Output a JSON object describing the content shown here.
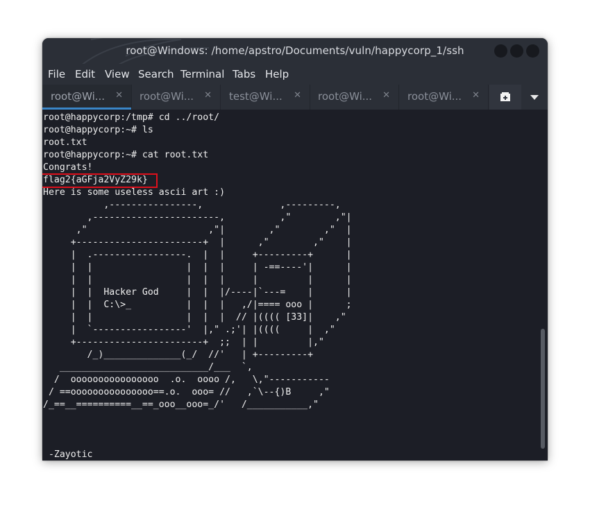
{
  "window": {
    "title": "root@Windows: /home/apstro/Documents/vuln/happycorp_1/ssh"
  },
  "menubar": {
    "items": [
      "File",
      "Edit",
      "View",
      "Search",
      "Terminal",
      "Tabs",
      "Help"
    ]
  },
  "tabs": [
    {
      "label": "root@Wi...",
      "active": true
    },
    {
      "label": "root@Wi...",
      "active": false
    },
    {
      "label": "test@Wi...",
      "active": false
    },
    {
      "label": "root@Wi...",
      "active": false
    },
    {
      "label": "root@Wi...",
      "active": false
    }
  ],
  "terminal": {
    "lines": [
      "root@happycorp:/tmp# cd ../root/",
      "root@happycorp:~# ls",
      "root.txt",
      "root@happycorp:~# cat root.txt",
      "Congrats!",
      "flag2{aGFja2VyZ29k}",
      "Here is some useless ascii art :)",
      "           ,----------------,              ,---------,",
      "        ,-----------------------,          ,\"        ,\"|",
      "      ,\"                      ,\"|        ,\"        ,\"  |",
      "     +-----------------------+  |      ,\"        ,\"    |",
      "     |  .-----------------.  |  |     +---------+      |",
      "     |  |                 |  |  |     | -==----'|      |",
      "     |  |                 |  |  |     |         |      |",
      "     |  |  Hacker God     |  |  |/----|`---=    |      |",
      "     |  |  C:\\>_          |  |  |   ,/|==== ooo |      ;",
      "     |  |                 |  |  |  // |(((( [33]|    ,\"",
      "     |  `-----------------'  |,\" .;'| |((((     |  ,\"",
      "     +-----------------------+  ;;  | |         |,\"",
      "        /_)______________(_/  //'   | +---------+",
      "   ___________________________/___  `,",
      "  /  oooooooooooooooo  .o.  oooo /,   \\,\"-----------",
      " / ==ooooooooooooooo==.o.  ooo= //   ,`\\--{)B     ,\"",
      "/_==__==========__==_ooo__ooo=_/'   /___________,\"",
      "",
      "",
      "",
      " -Zayotic"
    ]
  }
}
